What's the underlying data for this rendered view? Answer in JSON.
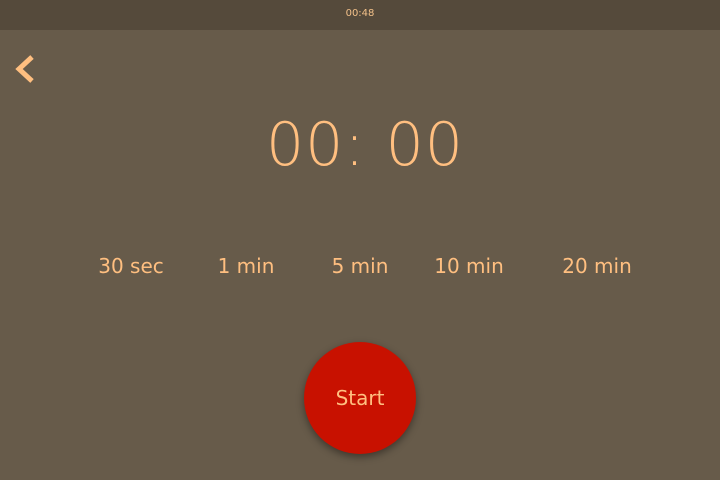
{
  "status_bar": {
    "time": "00:48"
  },
  "header": {
    "back_icon": "chevron-left-icon"
  },
  "timer": {
    "display": "00: 00"
  },
  "presets": [
    {
      "label": "30 sec"
    },
    {
      "label": "1 min"
    },
    {
      "label": "5 min"
    },
    {
      "label": "10 min"
    },
    {
      "label": "20 min"
    }
  ],
  "start_button": {
    "label": "Start"
  },
  "colors": {
    "background": "#675b4a",
    "status_bar": "#554a3b",
    "accent_text": "#ffbf80",
    "start_button": "#c81100"
  }
}
